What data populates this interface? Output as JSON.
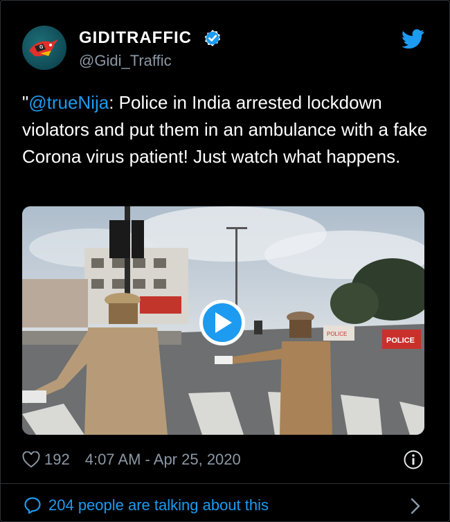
{
  "author": {
    "display_name": "GIDITRAFFIC",
    "handle": "@Gidi_Traffic",
    "verified": true
  },
  "tweet": {
    "prefix": "\"",
    "mention": "@trueNija",
    "body": ": Police in India arrested lockdown violators and put them in an ambulance with a fake Corona virus patient! Just watch what happens."
  },
  "media": {
    "type": "video",
    "sign_text_1": "POLICE",
    "sign_text_2": "POLICE"
  },
  "stats": {
    "likes": "192",
    "timestamp": "4:07 AM - Apr 25, 2020"
  },
  "footer": {
    "conversation_text": "204 people are talking about this"
  },
  "colors": {
    "accent": "#1d9bf0",
    "background": "#000000",
    "secondary_text": "#8b98a5",
    "primary_text": "#ffffff"
  },
  "icons": [
    "twitter-bird-icon",
    "verified-badge-icon",
    "play-icon",
    "heart-icon",
    "info-icon",
    "comment-bubble-icon",
    "chevron-right-icon"
  ]
}
